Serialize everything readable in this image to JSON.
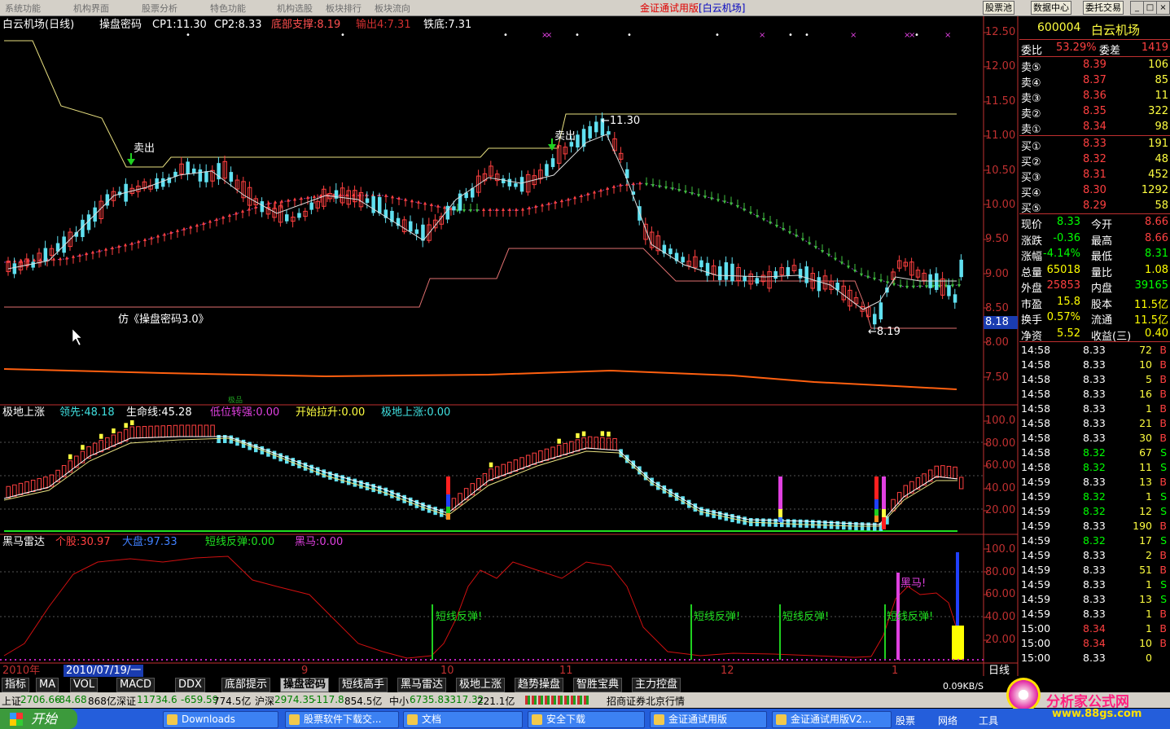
{
  "menu": [
    "系统功能",
    "机构界面",
    "股票分析",
    "特色功能",
    "机构选股",
    "板块排行",
    "板块流向"
  ],
  "app_title": "金证通试用版",
  "app_stock": "[白云机场]",
  "top_buttons": [
    "股票池",
    "数据中心",
    "委托交易"
  ],
  "main_header": {
    "name": "白云机场(日线)",
    "formula": "操盘密码",
    "cp1": "CP1:11.30",
    "cp2": "CP2:8.33",
    "support": "底部支撑:8.19",
    "out4": "输出4:7.31",
    "iron": "铁底:7.31"
  },
  "chart_annotations": {
    "sell1": "卖出",
    "sell2": "卖出",
    "high": "11.30",
    "low": "8.19",
    "imitation": "仿《操盘密码3.0》",
    "current": "8.18"
  },
  "price_axis": [
    "12.50",
    "12.00",
    "11.50",
    "11.00",
    "10.50",
    "10.00",
    "9.50",
    "9.00",
    "8.50",
    "8.00",
    "7.50"
  ],
  "sub1_header": {
    "title": "极地上涨",
    "lead": "领先:48.18",
    "life": "生命线:45.28",
    "low_strong": "低位转强:0.00",
    "start": "开始拉升:0.00",
    "polar": "极地上涨:0.00",
    "marker": "极品"
  },
  "sub1_axis": [
    "100.0",
    "80.00",
    "60.00",
    "40.00",
    "20.00"
  ],
  "sub2_header": {
    "title": "黑马雷达",
    "stock": "个股:30.97",
    "market": "大盘:97.33",
    "rebound": "短线反弹:0.00",
    "horse": "黑马:0.00"
  },
  "sub2_axis": [
    "100.0",
    "80.00",
    "60.00",
    "40.00",
    "20.00"
  ],
  "sub2_labels": [
    "短线反弹!",
    "短线反弹!",
    "短线反弹!",
    "短线反弹!"
  ],
  "horse_label": "黑马!",
  "date_axis": {
    "year": "2010年",
    "cursor_date": "2010/07/19/一",
    "months": [
      "9",
      "10",
      "11",
      "12",
      "1"
    ],
    "period": "日线"
  },
  "tabs": [
    "指标",
    "MA",
    "VOL",
    "MACD",
    "DDX",
    "底部提示",
    "操盘密码",
    "短线高手",
    "黑马雷达",
    "极地上涨",
    "趋势操盘",
    "智胜宝典",
    "主力控盘"
  ],
  "active_tab": "操盘密码",
  "quote": {
    "code": "600004",
    "name": "白云机场",
    "weibi_label": "委比",
    "weibi": "53.29%",
    "weicha_label": "委差",
    "weicha": "1419",
    "sells": [
      {
        "label": "卖⑤",
        "price": "8.39",
        "vol": "106"
      },
      {
        "label": "卖④",
        "price": "8.37",
        "vol": "85"
      },
      {
        "label": "卖③",
        "price": "8.36",
        "vol": "11"
      },
      {
        "label": "卖②",
        "price": "8.35",
        "vol": "322"
      },
      {
        "label": "卖①",
        "price": "8.34",
        "vol": "98"
      }
    ],
    "buys": [
      {
        "label": "买①",
        "price": "8.33",
        "vol": "191"
      },
      {
        "label": "买②",
        "price": "8.32",
        "vol": "48"
      },
      {
        "label": "买③",
        "price": "8.31",
        "vol": "452"
      },
      {
        "label": "买④",
        "price": "8.30",
        "vol": "1292"
      },
      {
        "label": "买⑤",
        "price": "8.29",
        "vol": "58"
      }
    ],
    "stats": [
      {
        "l1": "现价",
        "v1": "8.33",
        "l2": "今开",
        "v2": "8.66",
        "c1": "#00ff00",
        "c2": "#ff4040"
      },
      {
        "l1": "涨跌",
        "v1": "-0.36",
        "l2": "最高",
        "v2": "8.66",
        "c1": "#00ff00",
        "c2": "#ff4040"
      },
      {
        "l1": "涨幅",
        "v1": "-4.14%",
        "l2": "最低",
        "v2": "8.31",
        "c1": "#00ff00",
        "c2": "#00ff00"
      },
      {
        "l1": "总量",
        "v1": "65018",
        "l2": "量比",
        "v2": "1.08",
        "c1": "#ffff00",
        "c2": "#ffff00"
      },
      {
        "l1": "外盘",
        "v1": "25853",
        "l2": "内盘",
        "v2": "39165",
        "c1": "#ff4040",
        "c2": "#00ff00"
      },
      {
        "l1": "市盈",
        "v1": "15.8",
        "l2": "股本",
        "v2": "11.5亿",
        "c1": "#ffff00",
        "c2": "#ffff00"
      },
      {
        "l1": "换手",
        "v1": "0.57%",
        "l2": "流通",
        "v2": "11.5亿",
        "c1": "#ffff00",
        "c2": "#ffff00"
      },
      {
        "l1": "净资",
        "v1": "5.52",
        "l2": "收益(三)",
        "v2": "0.40",
        "c1": "#ffff00",
        "c2": "#ffff00"
      }
    ],
    "ticks": [
      {
        "t": "14:58",
        "p": "8.33",
        "v": "72",
        "s": "B"
      },
      {
        "t": "14:58",
        "p": "8.33",
        "v": "10",
        "s": "B"
      },
      {
        "t": "14:58",
        "p": "8.33",
        "v": "5",
        "s": "B"
      },
      {
        "t": "14:58",
        "p": "8.33",
        "v": "16",
        "s": "B"
      },
      {
        "t": "14:58",
        "p": "8.33",
        "v": "1",
        "s": "B"
      },
      {
        "t": "14:58",
        "p": "8.33",
        "v": "21",
        "s": "B"
      },
      {
        "t": "14:58",
        "p": "8.33",
        "v": "30",
        "s": "B"
      },
      {
        "t": "14:58",
        "p": "8.32",
        "v": "67",
        "s": "S"
      },
      {
        "t": "14:58",
        "p": "8.32",
        "v": "11",
        "s": "S"
      },
      {
        "t": "14:59",
        "p": "8.33",
        "v": "13",
        "s": "B"
      },
      {
        "t": "14:59",
        "p": "8.32",
        "v": "1",
        "s": "S"
      },
      {
        "t": "14:59",
        "p": "8.32",
        "v": "12",
        "s": "S"
      },
      {
        "t": "14:59",
        "p": "8.33",
        "v": "190",
        "s": "B"
      },
      {
        "t": "14:59",
        "p": "8.32",
        "v": "17",
        "s": "S"
      },
      {
        "t": "14:59",
        "p": "8.33",
        "v": "2",
        "s": "B"
      },
      {
        "t": "14:59",
        "p": "8.33",
        "v": "51",
        "s": "B"
      },
      {
        "t": "14:59",
        "p": "8.33",
        "v": "1",
        "s": "S"
      },
      {
        "t": "14:59",
        "p": "8.33",
        "v": "13",
        "s": "S"
      },
      {
        "t": "14:59",
        "p": "8.33",
        "v": "1",
        "s": "B"
      },
      {
        "t": "15:00",
        "p": "8.34",
        "v": "1",
        "s": "B"
      },
      {
        "t": "15:00",
        "p": "8.34",
        "v": "10",
        "s": "B"
      },
      {
        "t": "15:00",
        "p": "8.33",
        "v": "0",
        "s": ""
      }
    ]
  },
  "status": {
    "sh_label": "上证",
    "sh": "2706.66",
    "sh_chg": "-84.68",
    "sh_amt": "868亿",
    "sz_label": "深证",
    "sz": "11734.6",
    "sz_chg": "-659.59",
    "sz_amt": "774.5亿",
    "hs_label": "沪深",
    "hs": "2974.35",
    "hs_chg": "-117.8",
    "hs_amt": "854.5亿",
    "zx_label": "中小",
    "zx": "6735.83",
    "zx_chg": "-317.32",
    "zx_amt": "221.1亿",
    "broker": "招商证券北京行情",
    "net": "0.09KB/S"
  },
  "taskbar": {
    "start": "开始",
    "tasks": [
      "Downloads",
      "股票软件下载交...",
      "文档",
      "安全下载",
      "金证通试用版",
      "金证通试用版V2..."
    ],
    "tray": [
      "股票",
      "网络",
      "工具"
    ]
  },
  "watermark": {
    "site": "分析家公式网",
    "url": "www.88gs.com"
  }
}
